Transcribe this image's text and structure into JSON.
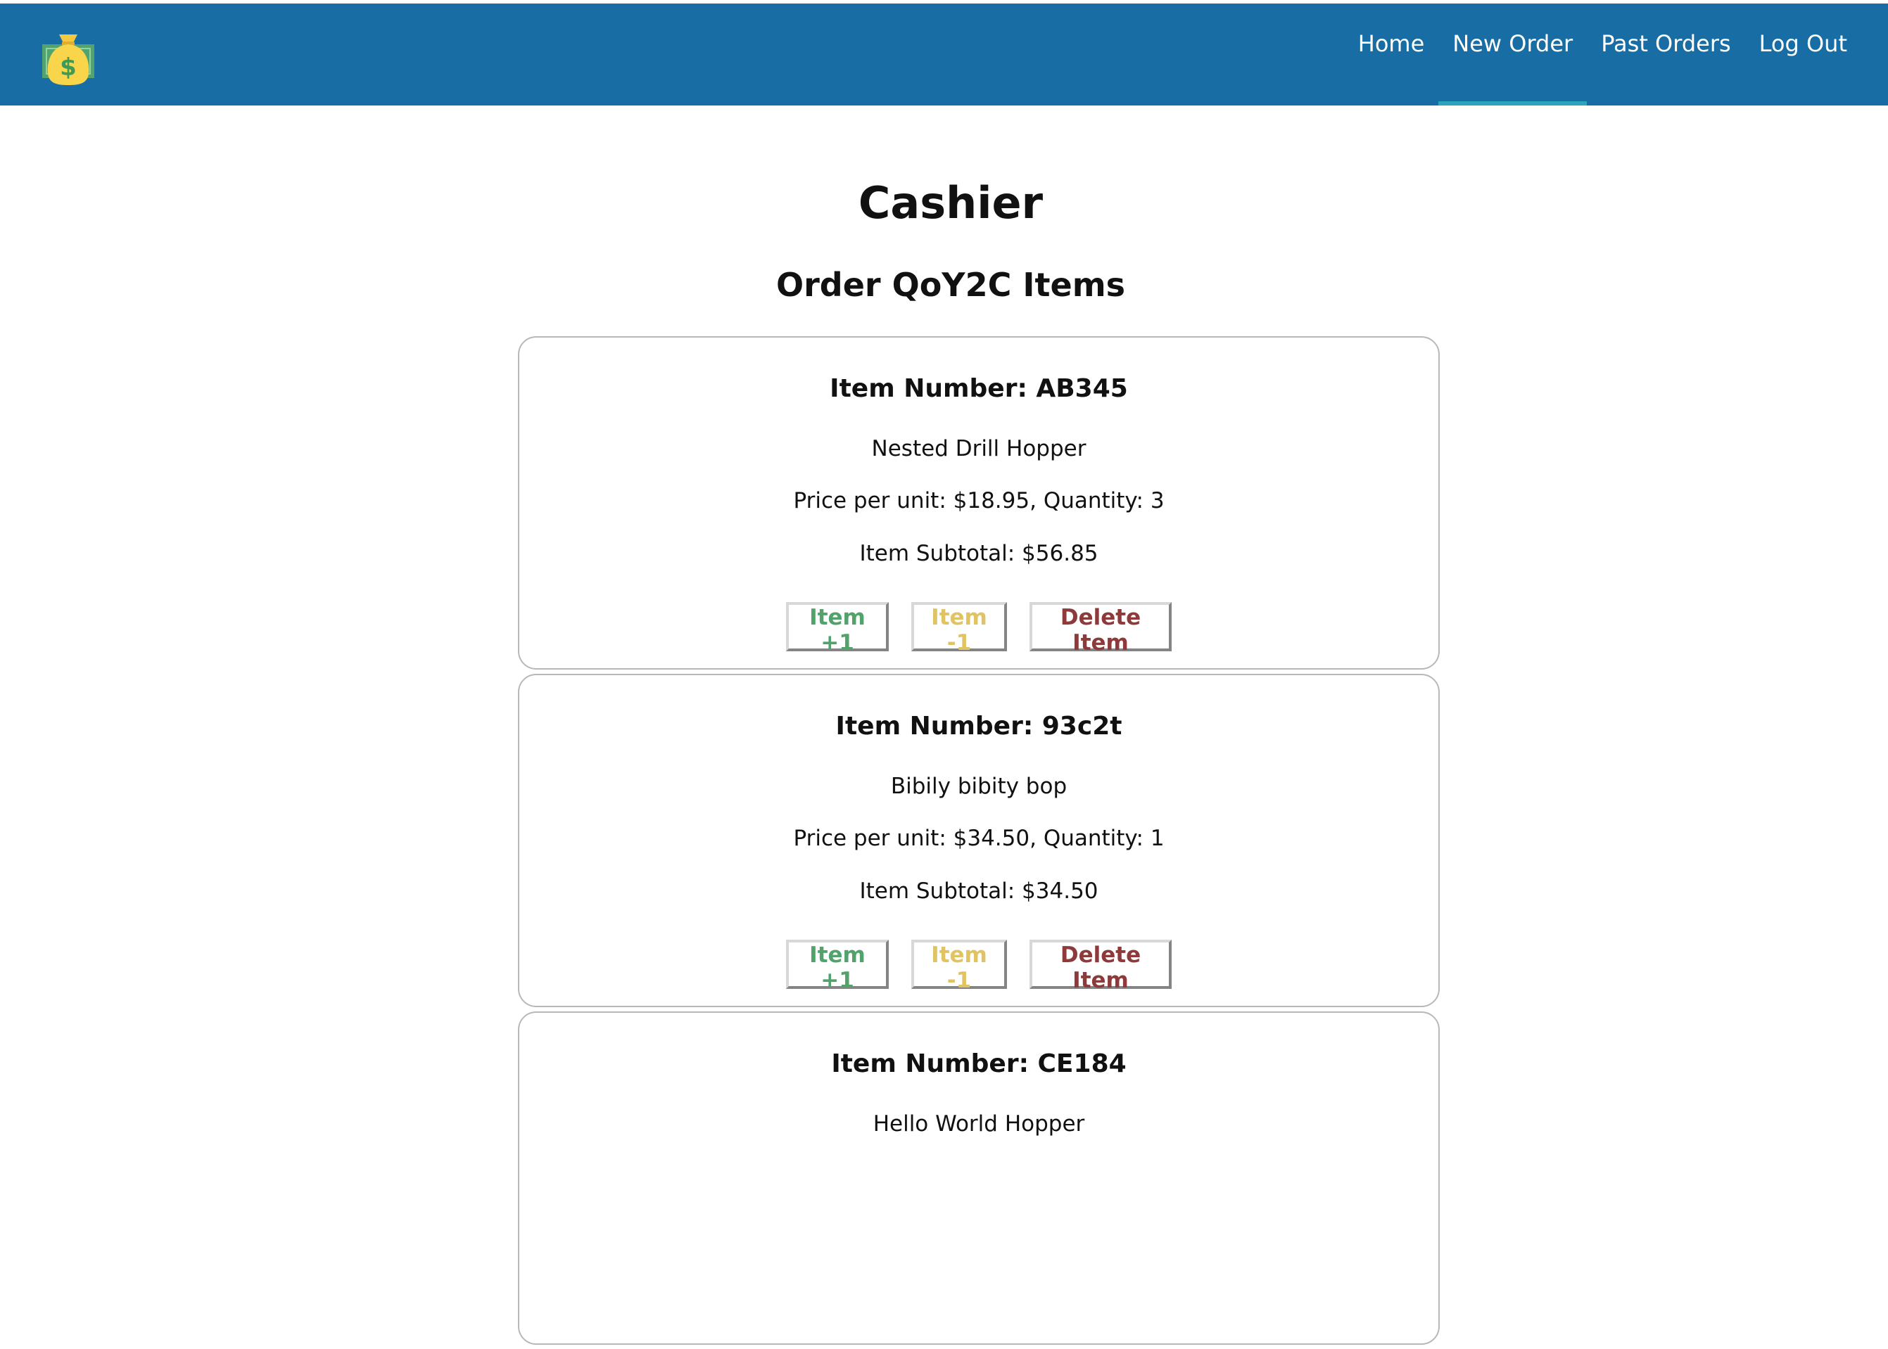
{
  "nav": {
    "logo_icon": "money-bag-icon",
    "links": [
      "Home",
      "New Order",
      "Past Orders",
      "Log Out"
    ],
    "active": "New Order",
    "bar_color": "#186ea4",
    "active_indicator_color": "#2aa5bd"
  },
  "page": {
    "title": "Cashier",
    "order_title": "Order QoY2C Items"
  },
  "items": [
    {
      "number": "Item Number: AB345",
      "name": "Nested Drill Hopper",
      "price_qty": "Price per unit: $18.95, Quantity: 3",
      "subtotal": "Item Subtotal: $56.85"
    },
    {
      "number": "Item Number: 93c2t",
      "name": "Bibily bibity bop",
      "price_qty": "Price per unit: $34.50, Quantity: 1",
      "subtotal": "Item Subtotal: $34.50"
    },
    {
      "number": "Item Number: CE184",
      "name": "Hello World Hopper",
      "price_qty": "",
      "subtotal": ""
    }
  ],
  "buttons": {
    "plus": "Item +1",
    "minus": "Item -1",
    "delete": "Delete Item",
    "plus_color": "#52a36b",
    "minus_color": "#e0c463",
    "delete_color": "#8e3a3a"
  }
}
